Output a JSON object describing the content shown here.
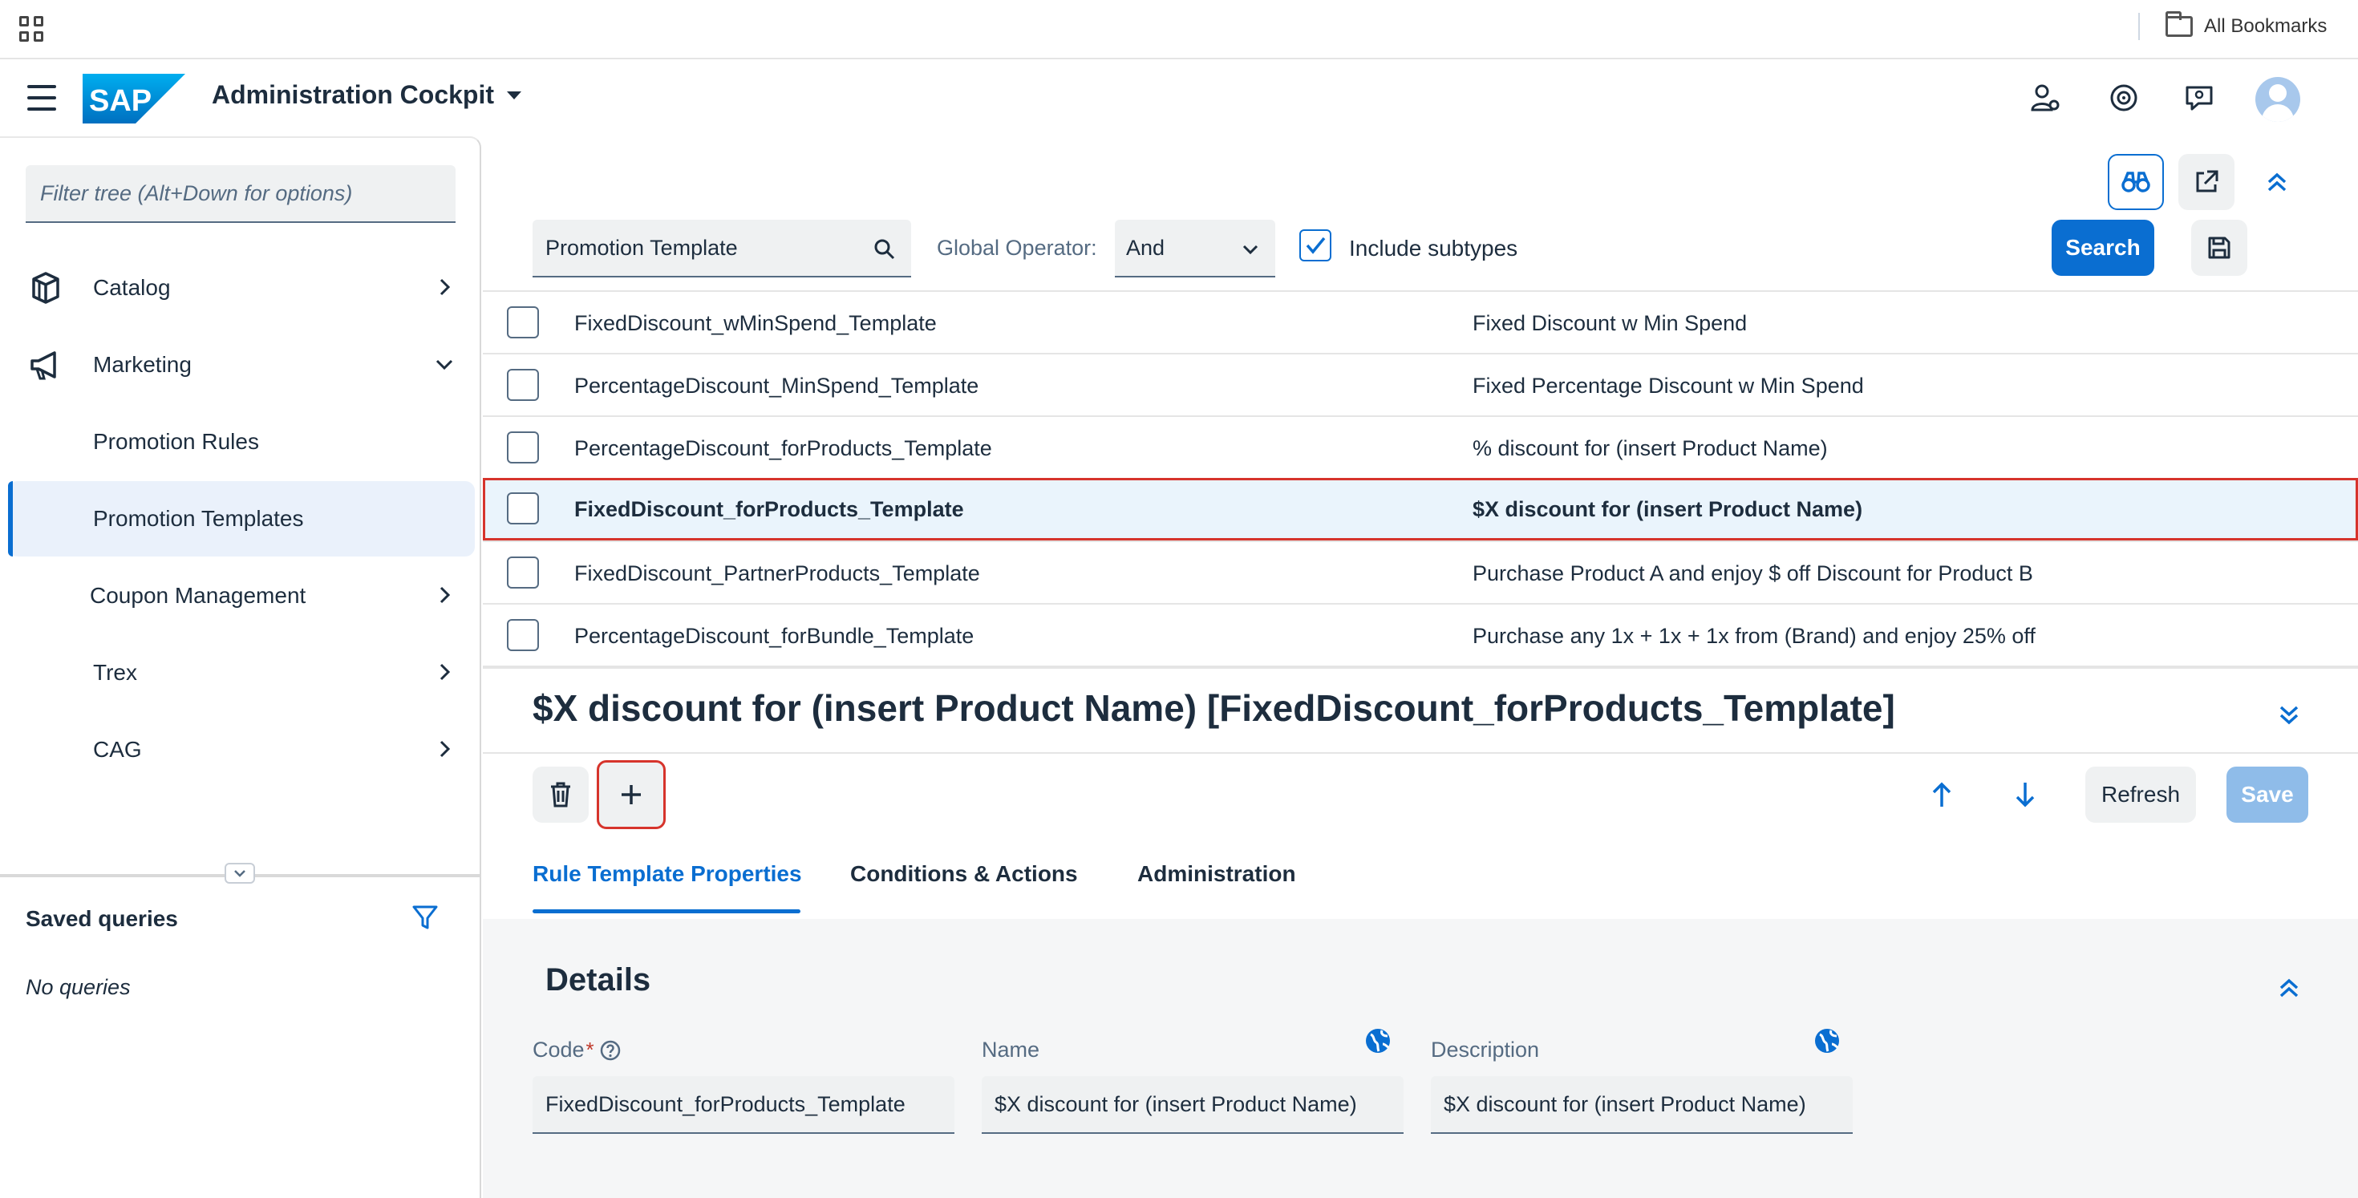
{
  "browser": {
    "bookmarks_label": "All Bookmarks"
  },
  "shell": {
    "title": "Administration Cockpit",
    "logo_text": "SAP"
  },
  "sidebar": {
    "filter_placeholder": "Filter tree (Alt+Down for options)",
    "items": [
      {
        "label": "Catalog",
        "icon": "catalog-icon",
        "has_chevron": "right"
      },
      {
        "label": "Marketing",
        "icon": "megaphone-icon",
        "has_chevron": "down"
      },
      {
        "label": "Promotion Rules"
      },
      {
        "label": "Promotion Templates",
        "selected": true
      },
      {
        "label": "Coupon Management",
        "has_chevron": "right"
      },
      {
        "label": "Trex",
        "has_chevron": "right"
      },
      {
        "label": "CAG",
        "has_chevron": "right"
      }
    ],
    "saved_queries_title": "Saved queries",
    "no_queries": "No queries"
  },
  "search": {
    "query": "Promotion Template",
    "global_operator_label": "Global Operator:",
    "global_operator_value": "And",
    "include_subtypes_label": "Include subtypes",
    "include_subtypes_checked": true,
    "search_button": "Search"
  },
  "results": {
    "rows": [
      {
        "code": "FixedDiscount_wMinSpend_Template",
        "name": "Fixed Discount w Min Spend"
      },
      {
        "code": "PercentageDiscount_MinSpend_Template",
        "name": "Fixed Percentage Discount w Min Spend"
      },
      {
        "code": "PercentageDiscount_forProducts_Template",
        "name": "% discount for (insert Product Name)"
      },
      {
        "code": "FixedDiscount_forProducts_Template",
        "name": "$X discount for (insert Product Name)",
        "selected": true
      },
      {
        "code": "FixedDiscount_PartnerProducts_Template",
        "name": "Purchase Product A and enjoy $ off Discount for Product B"
      },
      {
        "code": "PercentageDiscount_forBundle_Template",
        "name": "Purchase any 1x + 1x + 1x from (Brand) and enjoy 25% off"
      }
    ]
  },
  "editor": {
    "title": "$X discount for (insert Product Name) [FixedDiscount_forProducts_Template]",
    "refresh_button": "Refresh",
    "save_button": "Save",
    "tabs": [
      "Rule Template Properties",
      "Conditions & Actions",
      "Administration"
    ],
    "active_tab": "Rule Template Properties",
    "section_title": "Details",
    "fields": {
      "code_label": "Code",
      "code_required_mark": "*",
      "code_value": "FixedDiscount_forProducts_Template",
      "name_label": "Name",
      "name_value": "$X discount for (insert Product Name)",
      "description_label": "Description",
      "description_value": "$X discount for (insert Product Name)"
    }
  },
  "colors": {
    "accent": "#0a6ed1",
    "highlight_border": "#d6342c",
    "selected_row_bg": "#eaf4fc"
  }
}
